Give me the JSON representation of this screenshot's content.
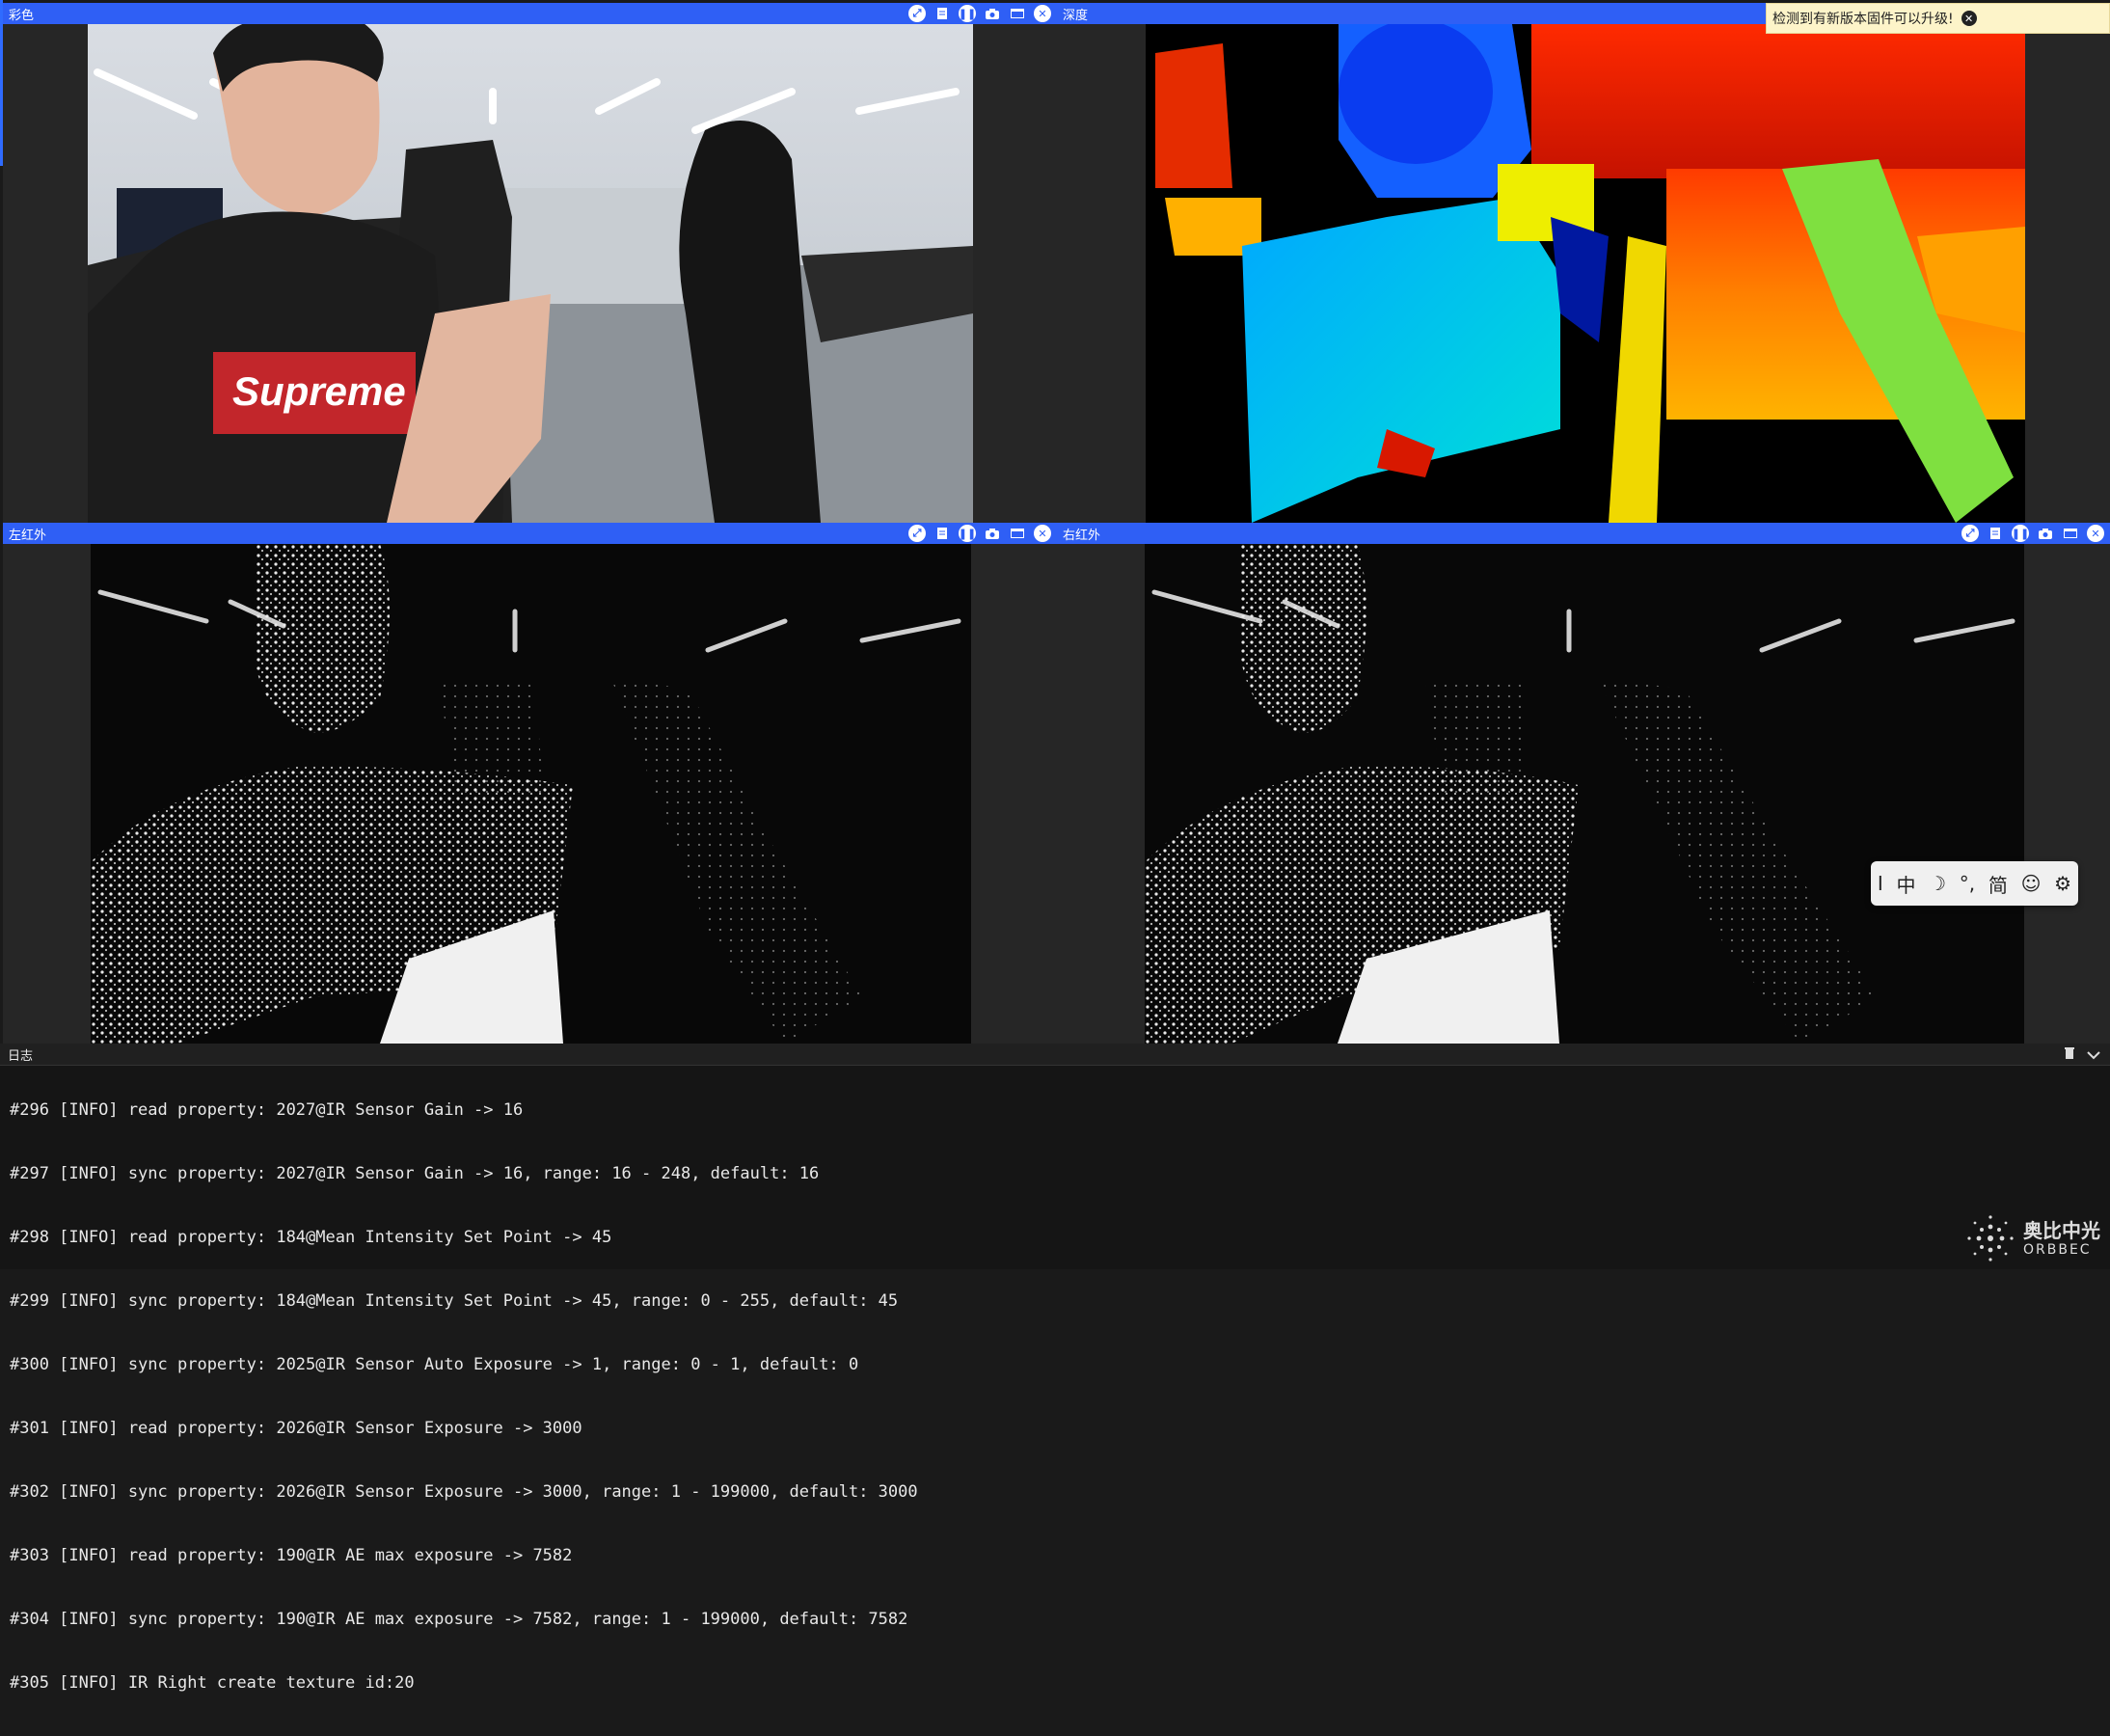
{
  "panels": {
    "color": {
      "title": "彩色"
    },
    "depth": {
      "title": "深度"
    },
    "ir_left": {
      "title": "左红外"
    },
    "ir_right": {
      "title": "右红外"
    }
  },
  "toolbar_icons": [
    "expand-icon",
    "info-icon",
    "pause-icon",
    "camera-icon",
    "window-icon",
    "close-icon"
  ],
  "notification": {
    "text": "检测到有新版本固件可以升级!"
  },
  "ime_bar": {
    "cursor": "I",
    "mode": "中",
    "moon": "☽",
    "punct": "°,",
    "simplified": "简",
    "emoji": "☺",
    "settings": "⚙"
  },
  "log": {
    "title": "日志",
    "lines": [
      "#296 [INFO] read property: 2027@IR Sensor Gain -> 16",
      "#297 [INFO] sync property: 2027@IR Sensor Gain -> 16, range: 16 - 248, default: 16",
      "#298 [INFO] read property: 184@Mean Intensity Set Point -> 45",
      "#299 [INFO] sync property: 184@Mean Intensity Set Point -> 45, range: 0 - 255, default: 45",
      "#300 [INFO] sync property: 2025@IR Sensor Auto Exposure -> 1, range: 0 - 1, default: 0",
      "#301 [INFO] read property: 2026@IR Sensor Exposure -> 3000",
      "#302 [INFO] sync property: 2026@IR Sensor Exposure -> 3000, range: 1 - 199000, default: 3000",
      "#303 [INFO] read property: 190@IR AE max exposure -> 7582",
      "#304 [INFO] sync property: 190@IR AE max exposure -> 7582, range: 1 - 199000, default: 7582",
      "#305 [INFO] IR Right create texture id:20"
    ]
  },
  "brand": {
    "name_cn": "奥比中光",
    "name_en": "ORBBEC"
  },
  "colors": {
    "accent": "#2f5ff5",
    "toast_bg": "#fdf4c9"
  }
}
